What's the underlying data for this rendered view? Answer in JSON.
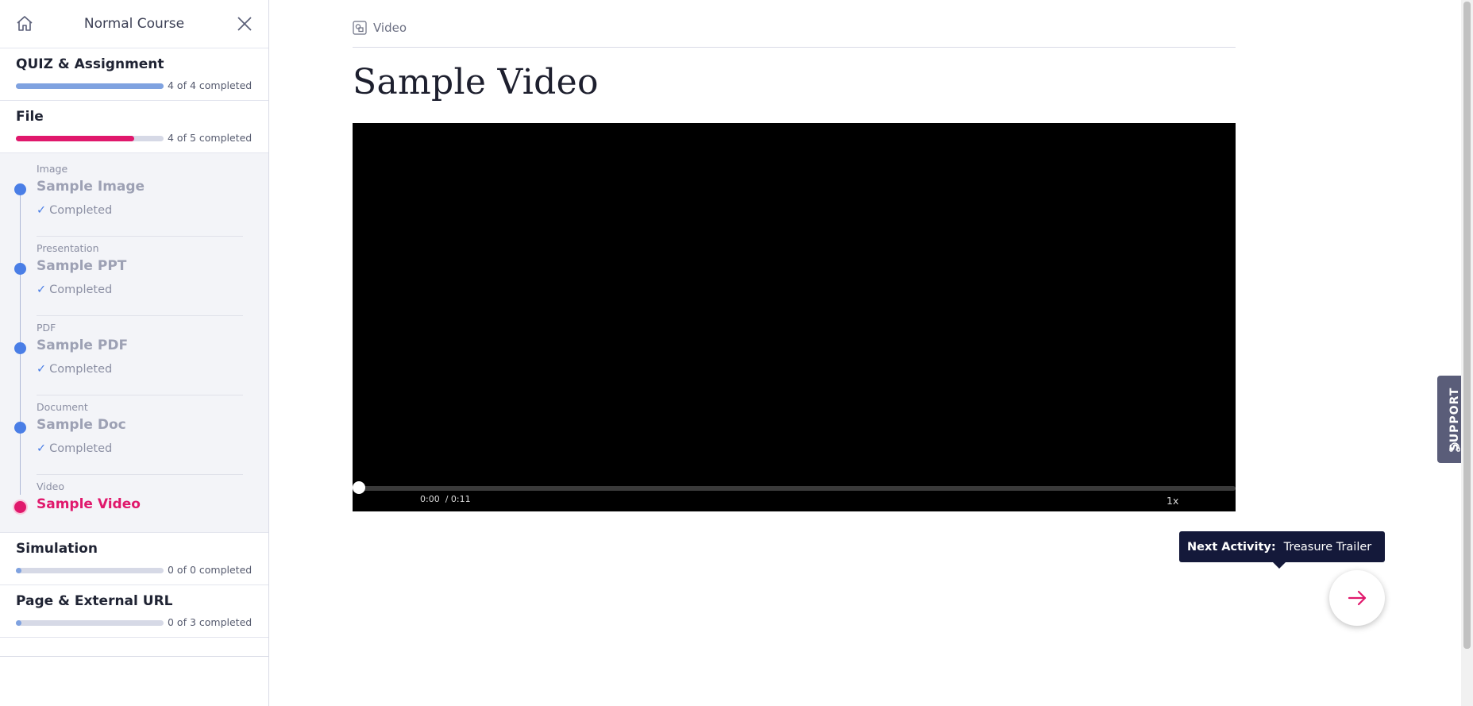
{
  "sidebar": {
    "title": "Normal Course",
    "sections_top": [
      {
        "title": "QUIZ & Assignment",
        "progress_text": "4 of 4 completed",
        "progress": 1.0,
        "color": "#7fa2e0"
      },
      {
        "title": "File",
        "progress_text": "4 of 5 completed",
        "progress": 0.8,
        "color": "#e0186c"
      }
    ],
    "activities": [
      {
        "type": "Image",
        "name": "Sample Image",
        "status": "Completed"
      },
      {
        "type": "Presentation",
        "name": "Sample PPT",
        "status": "Completed"
      },
      {
        "type": "PDF",
        "name": "Sample PDF",
        "status": "Completed"
      },
      {
        "type": "Document",
        "name": "Sample Doc",
        "status": "Completed"
      },
      {
        "type": "Video",
        "name": "Sample Video",
        "status": ""
      }
    ],
    "sections_bottom": [
      {
        "title": "Simulation",
        "progress_text": "0 of 0 completed",
        "progress": 0.0,
        "color": "#7fa2e0"
      },
      {
        "title": "Page & External URL",
        "progress_text": "0 of 3 completed",
        "progress": 0.0,
        "color": "#7fa2e0"
      }
    ]
  },
  "main": {
    "breadcrumb": "Video",
    "title": "Sample Video",
    "video": {
      "current_time": "0:00",
      "duration": "/ 0:11",
      "speed": "1x",
      "progress": 0.0
    }
  },
  "next_activity": {
    "label": "Next Activity:",
    "name": "Treasure Trailer"
  },
  "support": {
    "label": "SUPPORT"
  },
  "colors": {
    "accent_pink": "#e0186c",
    "accent_blue": "#4a7ee6",
    "dark_navy": "#14193a"
  },
  "icons": {
    "home": "home-icon",
    "close": "close-icon",
    "breadcrumb": "video-icon",
    "next": "arrow-right-icon",
    "support": "headset-icon"
  }
}
